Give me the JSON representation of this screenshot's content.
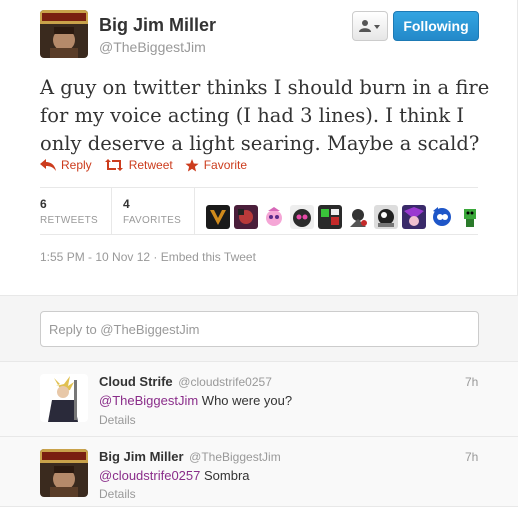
{
  "tweet": {
    "fullname": "Big Jim Miller",
    "screen_name": "@TheBiggestJim",
    "follow_label": "Following",
    "text": "A guy on twitter thinks I should burn in a fire for my voice acting (I had 3 lines). I think I only deserve a light searing. Maybe a scald?",
    "actions": {
      "reply": "Reply",
      "retweet": "Retweet",
      "favorite": "Favorite"
    },
    "retweets": {
      "count": "6",
      "label": "RETWEETS"
    },
    "favorites": {
      "count": "4",
      "label": "FAVORITES"
    },
    "timestamp": "1:55 PM - 10 Nov 12",
    "embed": "Embed this Tweet",
    "separator": "·"
  },
  "reply_box": {
    "placeholder": "Reply to @TheBiggestJim"
  },
  "replies": [
    {
      "name": "Cloud Strife",
      "screen_name": "@cloudstrife0257",
      "time": "7h",
      "mention": "@TheBiggestJim",
      "text": " Who were you?",
      "details": "Details"
    },
    {
      "name": "Big Jim Miller",
      "screen_name": "@TheBiggestJim",
      "time": "7h",
      "mention": "@cloudstrife0257",
      "text": " Sombra",
      "details": "Details"
    }
  ],
  "colors": {
    "link_red": "#cc3c1d",
    "follow_blue": "#2a97d8",
    "mention_purple": "#8a2d8a",
    "muted": "#999999"
  },
  "icons": [
    "user-dropdown-icon",
    "reply-icon",
    "retweet-icon",
    "star-icon"
  ]
}
